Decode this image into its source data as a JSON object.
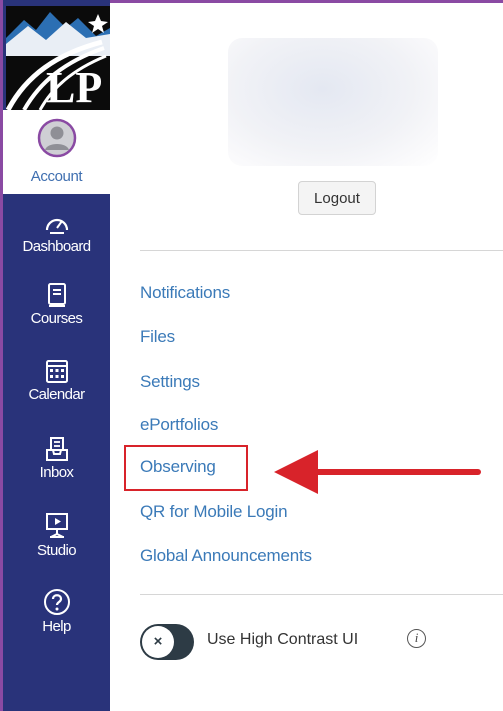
{
  "nav": {
    "account_label": "Account",
    "items": [
      {
        "label": "Dashboard",
        "icon": "dashboard-icon"
      },
      {
        "label": "Courses",
        "icon": "courses-icon"
      },
      {
        "label": "Calendar",
        "icon": "calendar-icon"
      },
      {
        "label": "Inbox",
        "icon": "inbox-icon"
      },
      {
        "label": "Studio",
        "icon": "studio-icon"
      },
      {
        "label": "Help",
        "icon": "help-icon"
      }
    ],
    "colors": {
      "background": "#29337a",
      "accent": "#8a4aa3",
      "text": "#ffffff"
    }
  },
  "logo": {
    "text": "LP"
  },
  "tray": {
    "logout_label": "Logout",
    "links": [
      {
        "label": "Notifications"
      },
      {
        "label": "Files"
      },
      {
        "label": "Settings"
      },
      {
        "label": "ePortfolios"
      },
      {
        "label": "Observing",
        "highlighted": true
      },
      {
        "label": "QR for Mobile Login"
      },
      {
        "label": "Global Announcements"
      }
    ],
    "link_color": "#3b7ab8",
    "highlight_color": "#d8232a",
    "high_contrast": {
      "label": "Use High Contrast UI",
      "enabled": false,
      "knob_symbol": "×",
      "info_symbol": "i"
    }
  }
}
